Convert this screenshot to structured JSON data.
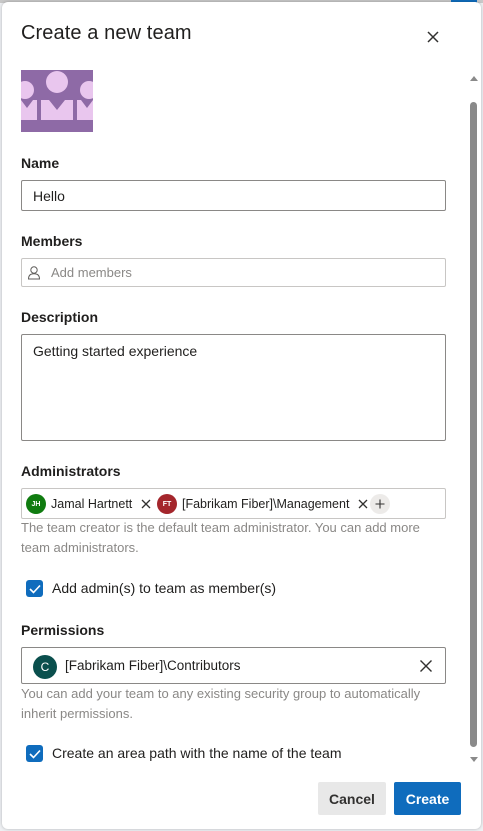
{
  "dialog": {
    "title": "Create a new team",
    "close_icon": "close-icon",
    "team_icon": "team-group-icon"
  },
  "name": {
    "label": "Name",
    "value": "Hello"
  },
  "members": {
    "label": "Members",
    "placeholder": "Add members",
    "icon": "person-icon"
  },
  "description": {
    "label": "Description",
    "value": "Getting started experience"
  },
  "administrators": {
    "label": "Administrators",
    "chips": [
      {
        "initials": "JH",
        "name": "Jamal Hartnett",
        "color": "#107c10"
      },
      {
        "initials": "FT",
        "name": "[Fabrikam Fiber]\\Management",
        "color": "#a4262c"
      }
    ],
    "add_icon": "add-icon",
    "helper": "The team creator is the default team administrator. You can add more team administrators."
  },
  "add_admins_checkbox": {
    "label": "Add admin(s) to team as member(s)",
    "checked": true
  },
  "permissions": {
    "label": "Permissions",
    "avatar_letter": "C",
    "avatar_color": "#0a4f4d",
    "value": "[Fabrikam Fiber]\\Contributors",
    "helper": "You can add your team to any existing security group to automatically inherit permissions."
  },
  "area_path_checkbox": {
    "label": "Create an area path with the name of the team",
    "checked": true
  },
  "footer": {
    "cancel_label": "Cancel",
    "create_label": "Create"
  },
  "colors": {
    "accent": "#0f6cbd",
    "team_icon_bg": "#8e6aa6",
    "team_icon_fg": "#e9c6ee"
  }
}
